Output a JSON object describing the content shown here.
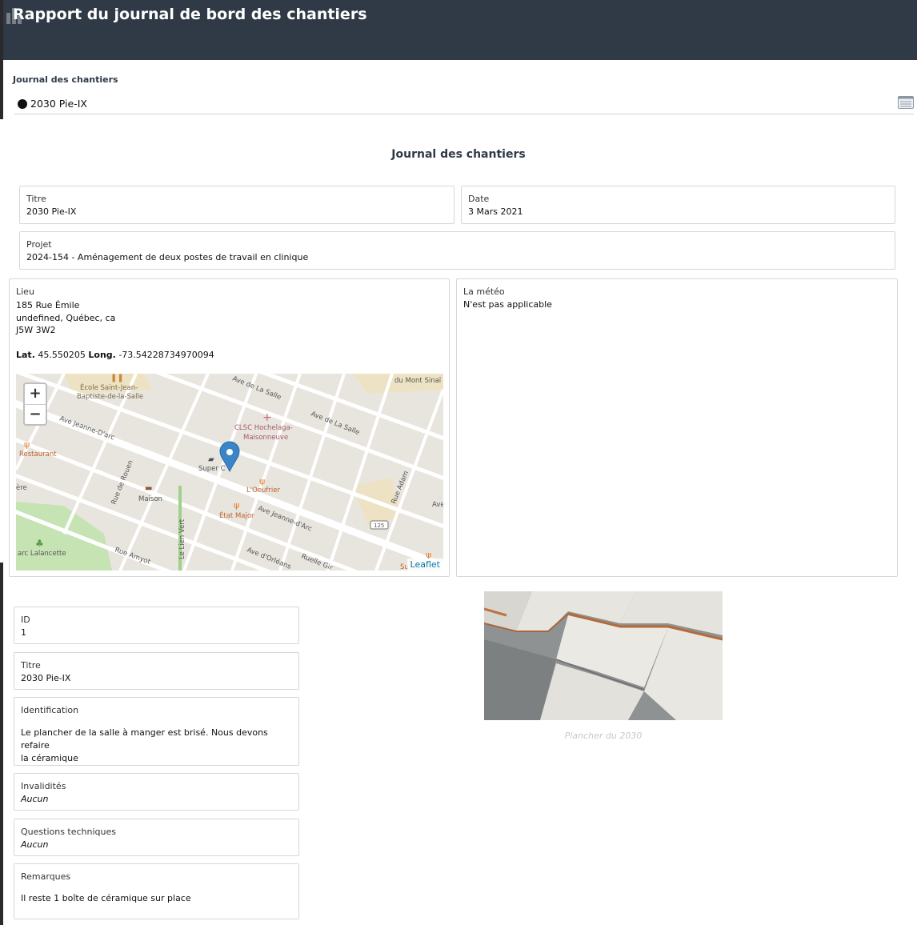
{
  "header": {
    "title": "Rapport du journal de bord des chantiers",
    "journal_label": "Journal des chantiers",
    "journal_value": "2030 Pie-IX"
  },
  "section_title": "Journal des chantiers",
  "info": {
    "titre_label": "Titre",
    "titre_value": "2030 Pie-IX",
    "date_label": "Date",
    "date_value": "3 Mars 2021",
    "projet_label": "Projet",
    "projet_value": "2024-154 - Aménagement de deux postes de travail en clinique"
  },
  "lieu": {
    "label": "Lieu",
    "line1": "185 Rue Émile",
    "line2": "undefined, Québec, ca",
    "line3": "J5W 3W2",
    "lat_label": "Lat.",
    "lat_value": "45.550205",
    "long_label": "Long.",
    "long_value": "-73.54228734970094"
  },
  "meteo": {
    "label": "La météo",
    "value": "N'est pas applicable"
  },
  "map": {
    "zoom_in": "+",
    "zoom_out": "−",
    "attribution": "Leaflet",
    "labels": {
      "ecole": "École Saint-Jean-",
      "ecole2": "Baptiste-de-la-Salle",
      "clsc": "CLSC Hochelaga-",
      "clsc2": "Maisonneuve",
      "mont_sinai": "du Mont Sinaï",
      "restaurant": "Restaurant",
      "super_c": "Super C",
      "oeufrier": "L'Oeufrier",
      "maison": "Maison",
      "etat_major": "État Major",
      "parc": "arc Lalancette",
      "rue_rouen": "Rue de Rouen",
      "rue_adam": "Rue Adam",
      "rue_amyot": "Rue Amyot",
      "ave_la_salle_1": "Ave de La Salle",
      "ave_la_salle_2": "Ave de La Salle",
      "ave_jeanne_1": "Ave Jeanne-D'arc",
      "ave_jeanne_2": "Ave Jeanne-d'Arc",
      "ave_orleans": "Ave d'Orléans",
      "ruelle": "Ruelle Gir",
      "lien_vert": "Le Lien Vert",
      "route": "125",
      "ere": "ère",
      "ave": "Ave",
      "su": "Su"
    }
  },
  "details": {
    "id_label": "ID",
    "id_value": "1",
    "titre_label": "Titre",
    "titre_value": "2030 Pie-IX",
    "identification_label": "Identification",
    "identification_line1": "Le plancher de la salle à manger est brisé. Nous devons refaire",
    "identification_line2": "la céramique",
    "invalidites_label": "Invalidités",
    "invalidites_value": "Aucun",
    "questions_label": "Questions techniques",
    "questions_value": "Aucun",
    "remarques_label": "Remarques",
    "remarques_value": "Il reste 1 boîte de céramique sur place"
  },
  "photo": {
    "caption": "Plancher du 2030"
  }
}
